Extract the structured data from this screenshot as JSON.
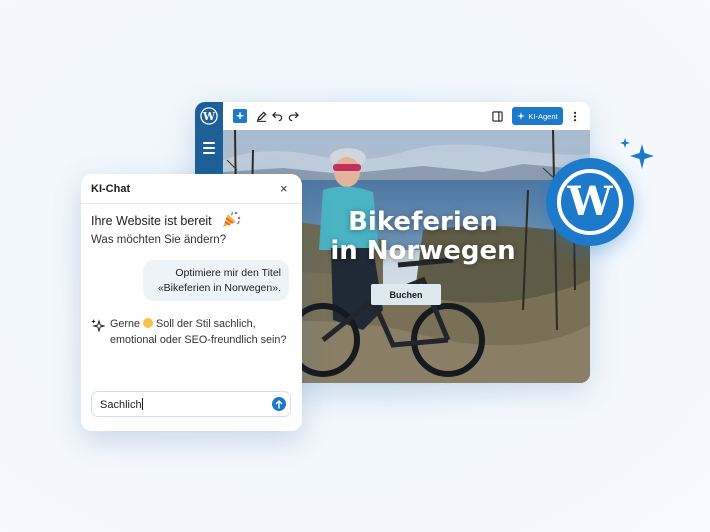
{
  "editor": {
    "toolbar": {
      "ki_agent_label": "KI-Agent"
    },
    "hero": {
      "title_line1": "Bikeferien",
      "title_line2": "in Norwegen",
      "button_label": "Buchen"
    }
  },
  "chat": {
    "title": "KI-Chat",
    "close_glyph": "×",
    "greeting": "Ihre Website ist bereit",
    "subline": "Was möchten Sie ändern?",
    "user_message_line1": "Optimiere mir den Titel",
    "user_message_line2": "«Bikeferien in Norwegen».",
    "ai_reply_lead": "Gerne",
    "ai_reply_rest": " Soll der Stil sachlich, emotional oder SEO-freundlich sein?",
    "input_value": "Sachlich"
  },
  "colors": {
    "brand_blue": "#1d7acb",
    "sidebar_blue": "#1d5f96",
    "bubble_bg": "#eef3f8"
  },
  "icons": [
    "wordpress-icon",
    "plus-icon",
    "pen-icon",
    "undo-icon",
    "redo-icon",
    "sidebar-toggle-icon",
    "sparkle-icon",
    "more-options-icon",
    "hamburger-icon",
    "close-icon",
    "party-popper-icon",
    "smiley-emoji-icon",
    "send-arrow-icon"
  ]
}
